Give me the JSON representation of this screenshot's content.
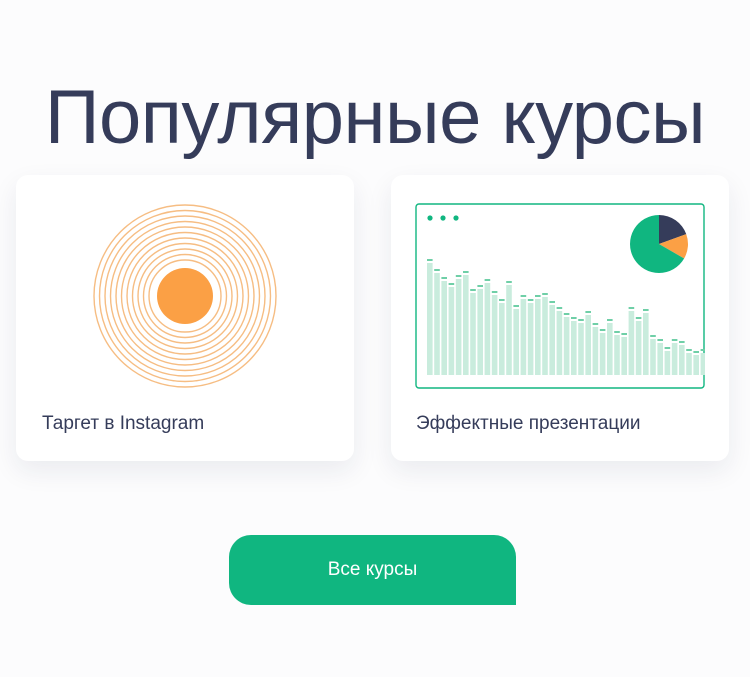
{
  "heading": "Популярные курсы",
  "courses": [
    {
      "title": "Таргет в Instagram",
      "illustration": "concentric-circles-icon"
    },
    {
      "title": "Эффектные презентации",
      "illustration": "dashboard-chart-icon"
    }
  ],
  "all_button": "Все курсы",
  "colors": {
    "heading": "#353c5a",
    "accent_green": "#10b680",
    "accent_orange": "#fba045",
    "ring_orange": "#f6bd83",
    "bar_light": "#c9ecdd",
    "navy": "#353c5a"
  }
}
